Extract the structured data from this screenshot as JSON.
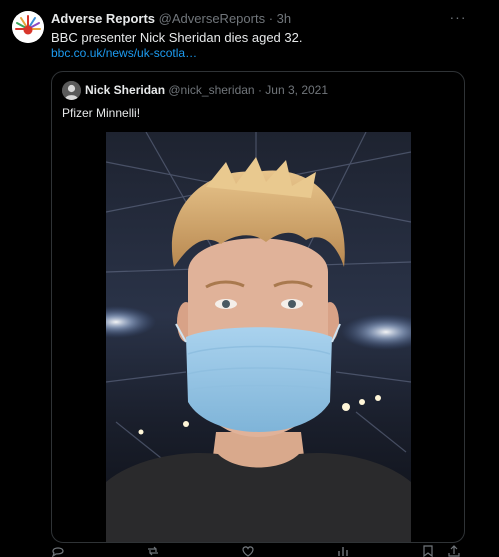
{
  "tweet": {
    "author_name": "Adverse Reports",
    "author_handle": "@AdverseReports",
    "separator": "·",
    "time": "3h",
    "text": "BBC presenter Nick Sheridan dies aged 32.",
    "link": "bbc.co.uk/news/uk-scotla…",
    "more_label": "···"
  },
  "quoted": {
    "author_name": "Nick Sheridan",
    "author_handle": "@nick_sheridan",
    "separator": "·",
    "date": "Jun 3, 2021",
    "text": "Pfizer Minnelli!"
  },
  "icons": {
    "avatar": "adverse-reports-logo",
    "quoted_avatar": "nick-sheridan-avatar",
    "more": "more-horizontal-icon",
    "reply": "reply-icon",
    "retweet": "retweet-icon",
    "like": "like-icon",
    "views": "views-icon",
    "share": "share-icon"
  },
  "colors": {
    "background": "#000000",
    "text": "#e7e9ea",
    "muted": "#71767b",
    "link": "#1d9bf0",
    "border": "#2f3336"
  }
}
